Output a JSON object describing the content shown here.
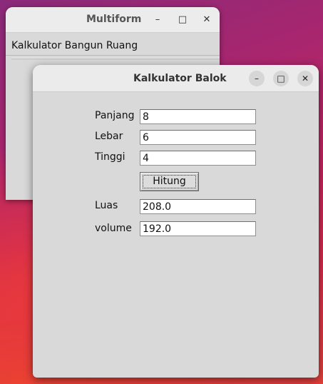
{
  "window_main": {
    "title": "Multiform",
    "controls": {
      "minimize": "–",
      "maximize": "□",
      "close": "✕"
    },
    "menu": {
      "item_label": "Kalkulator Bangun Ruang"
    }
  },
  "window_calc": {
    "title": "Kalkulator Balok",
    "controls": {
      "minimize": "–",
      "maximize": "□",
      "close": "✕"
    },
    "fields": {
      "panjang": {
        "label": "Panjang",
        "value": "8"
      },
      "lebar": {
        "label": "Lebar",
        "value": "6"
      },
      "tinggi": {
        "label": "Tinggi",
        "value": "4"
      }
    },
    "button_label": "Hitung",
    "results": {
      "luas": {
        "label": "Luas",
        "value": "208.0"
      },
      "volume": {
        "label": "volume",
        "value": "192.0"
      }
    }
  }
}
